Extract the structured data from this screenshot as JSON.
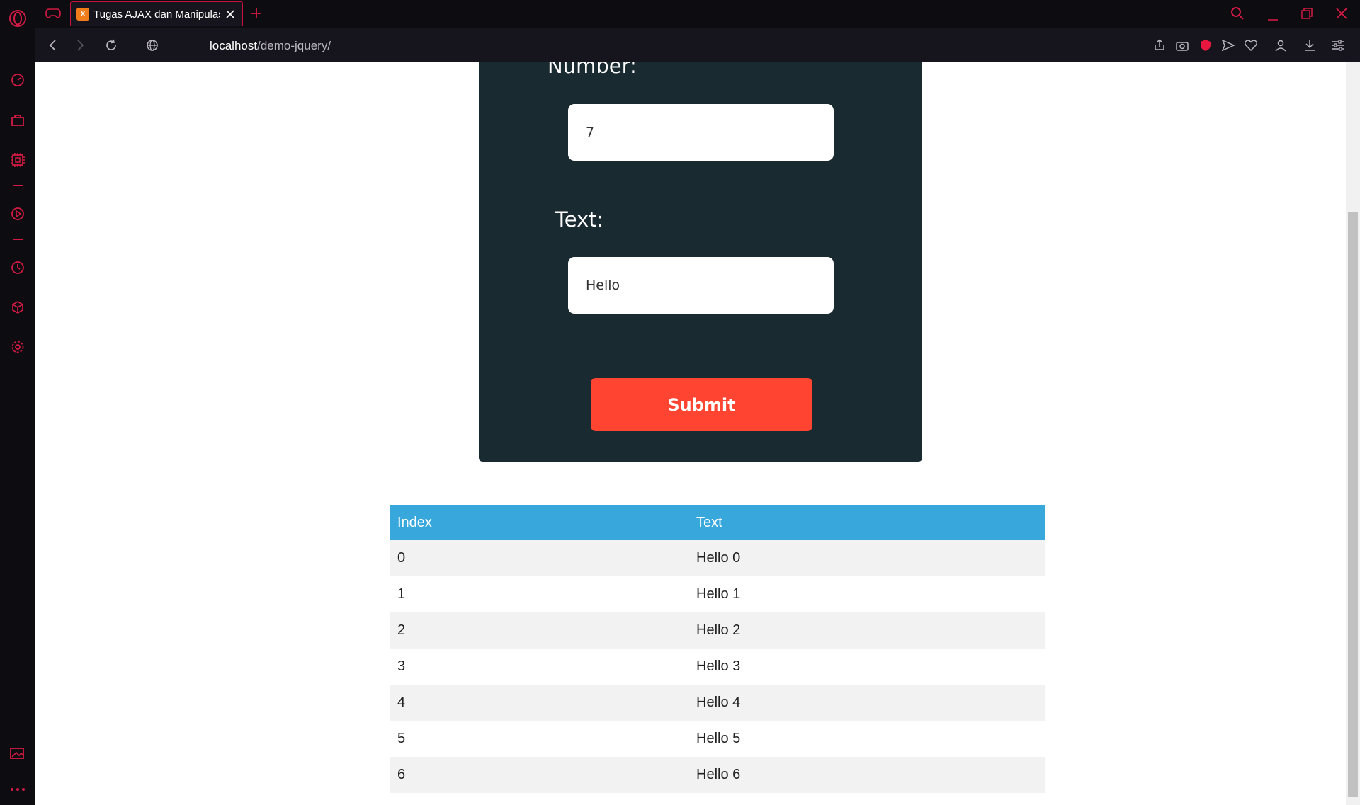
{
  "browser": {
    "tab": {
      "title": "Tugas AJAX dan Manipulas",
      "favicon": "xampp-favicon"
    },
    "address": {
      "host": "localhost",
      "path": "/demo-jquery/"
    },
    "accent_color": "#c8143c"
  },
  "form": {
    "number_label": "Number:",
    "number_value": "7",
    "text_label": "Text:",
    "text_value": "Hello",
    "submit_label": "Submit",
    "panel_color": "#192a31",
    "button_color": "#ff4431"
  },
  "table": {
    "header_color": "#38a8dc",
    "headers": {
      "index": "Index",
      "text": "Text"
    },
    "rows": [
      {
        "index": "0",
        "text": "Hello 0"
      },
      {
        "index": "1",
        "text": "Hello 1"
      },
      {
        "index": "2",
        "text": "Hello 2"
      },
      {
        "index": "3",
        "text": "Hello 3"
      },
      {
        "index": "4",
        "text": "Hello 4"
      },
      {
        "index": "5",
        "text": "Hello 5"
      },
      {
        "index": "6",
        "text": "Hello 6"
      }
    ]
  }
}
